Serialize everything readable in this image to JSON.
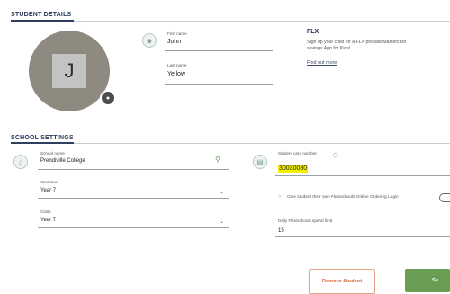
{
  "student_details": {
    "section_title": "STUDENT DETAILS",
    "avatar_initial": "J",
    "first_name_label": "First name",
    "first_name_value": "John",
    "last_name_label": "Last name",
    "last_name_value": "Yellow"
  },
  "flx": {
    "title": "FLX",
    "description_line1": "Sign up your child for a FLX prepaid Mastercard",
    "description_line2": "savings App for Kids!",
    "link": "Find out more"
  },
  "school_settings": {
    "section_title": "SCHOOL SETTINGS",
    "school_name_label": "School name",
    "school_name_value": "Prendiville College",
    "year_level_label": "Year level",
    "year_level_value": "Year 7",
    "class_label": "Class",
    "class_value": "Year 7",
    "student_card_label": "Student card number",
    "student_card_value": "30030030",
    "info_icon": "i",
    "checkbox_text": "Give student their own Flexischools Online Ordering Login",
    "daily_limit_label": "Daily Flexischools spend limit",
    "daily_limit_value": "15"
  },
  "actions": {
    "remove_label": "Remove Student",
    "save_label": "Sa"
  },
  "icons": {
    "avatar_camera": "camera-icon",
    "person_ring": "person-icon",
    "school_ring": "school-icon",
    "card_ring": "card-icon",
    "search": "search-icon",
    "chevron": "chevron-down-icon"
  },
  "colors": {
    "section_accent": "#2f3f60",
    "save_green": "#6a9d54",
    "remove_orange": "#d96a3e",
    "highlight_yellow": "#f2f000"
  }
}
